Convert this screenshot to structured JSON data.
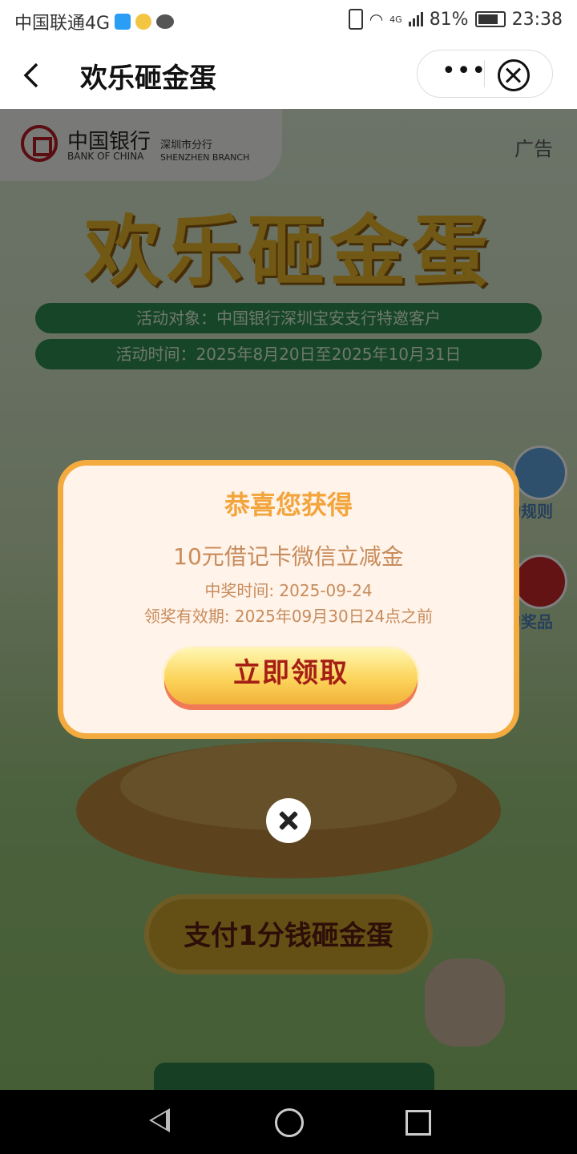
{
  "status_bar": {
    "carrier": "中国联通4G",
    "network": "4G",
    "battery": "81%",
    "time": "23:38"
  },
  "title_bar": {
    "title": "欢乐砸金蛋",
    "more_icon": "more-dots-icon",
    "close_icon": "close-circle-icon"
  },
  "page": {
    "bank_name_cn": "中国银行",
    "bank_name_en": "BANK OF CHINA",
    "branch_cn": "深圳市分行",
    "branch_en": "SHENZHEN BRANCH",
    "ad_label": "广告",
    "hero_title": "欢乐砸金蛋",
    "target_text": "活动对象：中国银行深圳宝安支行特邀客户",
    "time_text": "活动时间：2025年8月20日至2025年10月31日",
    "rules_label": "动规则",
    "prizes_label": "的奖品",
    "pay_button": "支付1分钱砸金蛋"
  },
  "modal": {
    "title": "恭喜您获得",
    "prize": "10元借记卡微信立减金",
    "win_time": "中奖时间: 2025-09-24",
    "valid_until": "领奖有效期: 2025年09月30日24点之前",
    "claim_button": "立即领取"
  },
  "colors": {
    "accent_orange": "#f3ab3f",
    "claim_text_red": "#a51f15",
    "boc_red": "#b51d23"
  }
}
